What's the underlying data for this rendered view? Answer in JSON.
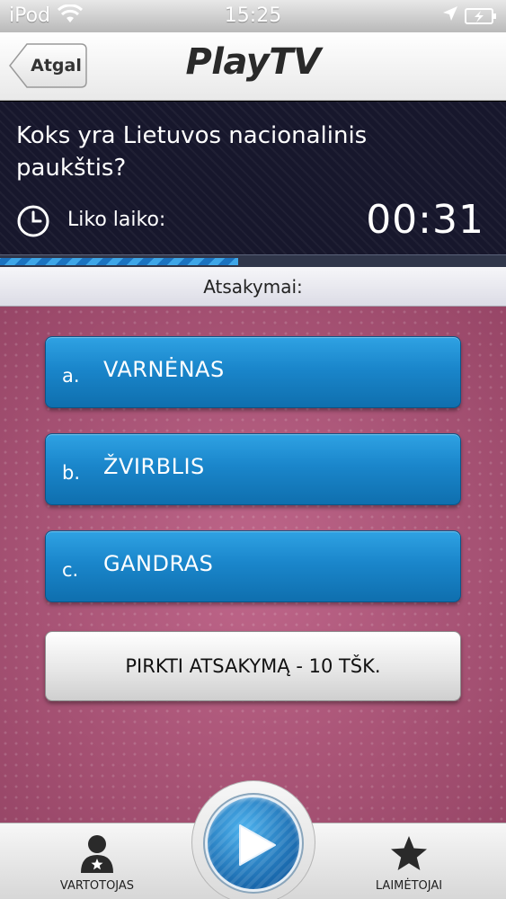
{
  "status_bar": {
    "carrier": "iPod",
    "time": "15:25"
  },
  "nav": {
    "back_label": "Atgal",
    "title": "PlayTV"
  },
  "question": {
    "text": "Koks yra Lietuvos nacionalinis paukštis?",
    "time_label": "Liko laiko:",
    "time_value": "00:31",
    "progress_fraction": 0.47
  },
  "answers_header": "Atsakymai:",
  "answers": [
    {
      "letter": "a.",
      "text": "VARNĖNAS"
    },
    {
      "letter": "b.",
      "text": "ŽVIRBLIS"
    },
    {
      "letter": "c.",
      "text": "GANDRAS"
    }
  ],
  "buy_button": "PIRKTI ATSAKYMĄ - 10 TŠK.",
  "tabbar": {
    "left_label": "VARTOTOJAS",
    "right_label": "LAIMĖTOJAI"
  },
  "icons": {
    "wifi": "wifi-icon",
    "location": "location-arrow-icon",
    "battery": "battery-charging-icon",
    "clock": "clock-icon",
    "user": "user-icon",
    "star": "star-icon",
    "play": "play-icon"
  },
  "colors": {
    "answer_blue": "#1a86cb",
    "panel_navy": "#17172c",
    "content_pink": "#b8557d"
  }
}
